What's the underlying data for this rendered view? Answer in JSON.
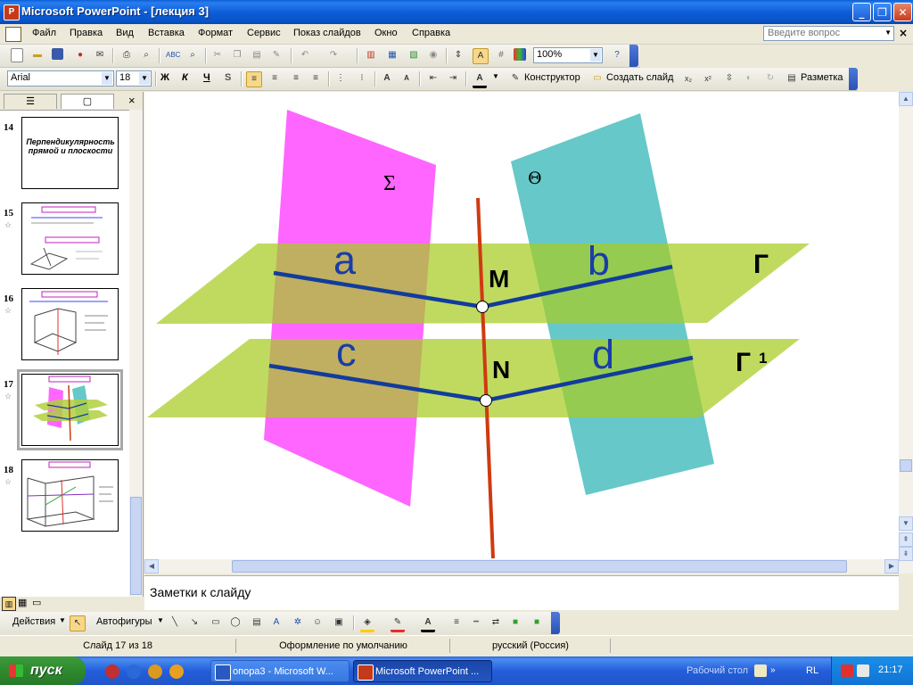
{
  "window": {
    "title": "Microsoft PowerPoint - [лекция 3]"
  },
  "menu": {
    "items": [
      "Файл",
      "Правка",
      "Вид",
      "Вставка",
      "Формат",
      "Сервис",
      "Показ слайдов",
      "Окно",
      "Справка"
    ],
    "help_placeholder": "Введите вопрос"
  },
  "toolbar_standard": {
    "zoom": "100%"
  },
  "toolbar_format": {
    "font": "Arial",
    "size": "18",
    "bold": "Ж",
    "italic": "К",
    "underline": "Ч",
    "shadow": "S",
    "designer": "Конструктор",
    "new_slide": "Создать слайд",
    "layout": "Разметка"
  },
  "slides": [
    {
      "number": "14",
      "title": "Перпендикулярность прямой и плоскости"
    },
    {
      "number": "15"
    },
    {
      "number": "16"
    },
    {
      "number": "17"
    },
    {
      "number": "18"
    }
  ],
  "slide": {
    "labels": {
      "sigma": "Σ",
      "theta": "Θ",
      "a": "a",
      "b": "b",
      "c": "c",
      "d": "d",
      "M": "M",
      "N": "N",
      "gamma": "Г",
      "gamma1": "Г",
      "gamma1_sup": "1"
    }
  },
  "notes": {
    "placeholder": "Заметки к слайду"
  },
  "drawing_toolbar": {
    "actions": "Действия",
    "autoshapes": "Автофигуры"
  },
  "status": {
    "slide": "Слайд 17 из 18",
    "design": "Оформление по умолчанию",
    "language": "русский (Россия)"
  },
  "taskbar": {
    "start": "пуск",
    "tasks": [
      "опора3 - Microsoft W...",
      "Microsoft PowerPoint ..."
    ],
    "desktop": "Рабочий стол",
    "lang": "RL",
    "clock": "21:17"
  },
  "colors": {
    "plane_sigma": "#ff66ff",
    "plane_theta": "#66c8c8",
    "plane_gamma": "#b0d040",
    "line_blue": "#123c9c",
    "line_red": "#d03a10",
    "label_blue": "#1a3ca8"
  }
}
